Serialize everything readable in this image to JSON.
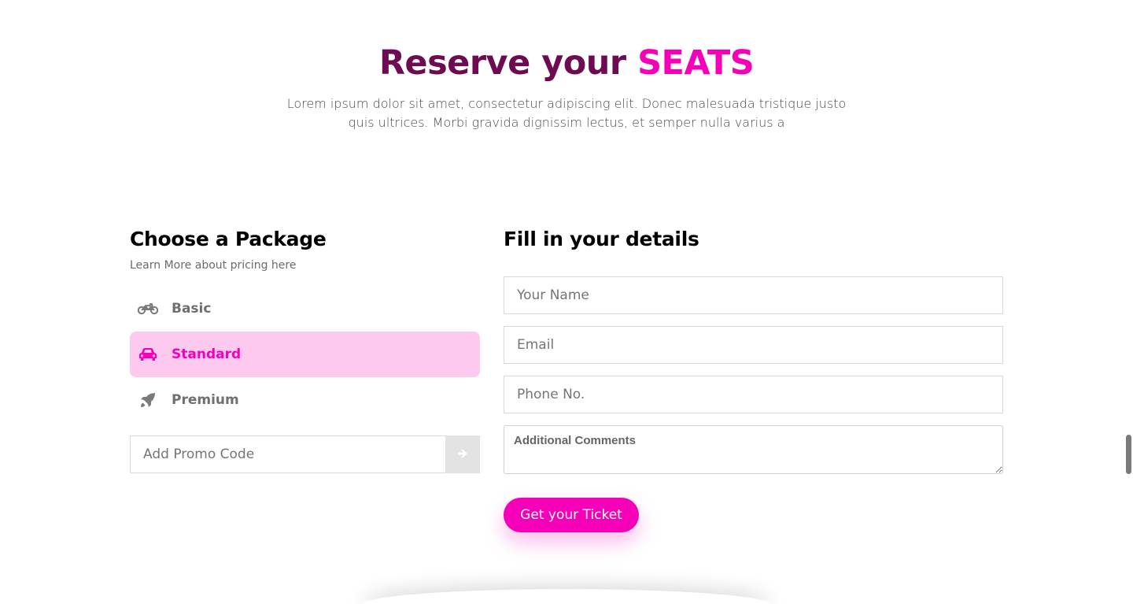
{
  "header": {
    "title_main": "Reserve your ",
    "title_accent": "SEATS",
    "subtitle": "Lorem ipsum dolor sit amet, consectetur adipiscing elit. Donec malesuada tristique justo quis ultrices. Morbi gravida dignissim lectus, et semper nulla varius a"
  },
  "package": {
    "heading": "Choose a Package",
    "pricing_link": "Learn More about pricing here",
    "items": [
      {
        "label": "Basic",
        "icon": "motorcycle-icon",
        "active": false
      },
      {
        "label": "Standard",
        "icon": "car-icon",
        "active": true
      },
      {
        "label": "Premium",
        "icon": "rocket-icon",
        "active": false
      }
    ],
    "promo": {
      "placeholder": "Add Promo Code",
      "button_icon": "arrow-right-icon"
    }
  },
  "details": {
    "heading": "Fill in your details",
    "name_placeholder": "Your Name",
    "email_placeholder": "Email",
    "phone_placeholder": "Phone No.",
    "comments_placeholder": "Additional Comments",
    "submit_label": "Get your Ticket"
  },
  "colors": {
    "brand_dark": "#6e0a52",
    "brand_accent": "#f500b8",
    "active_bg": "#fec9ef"
  }
}
